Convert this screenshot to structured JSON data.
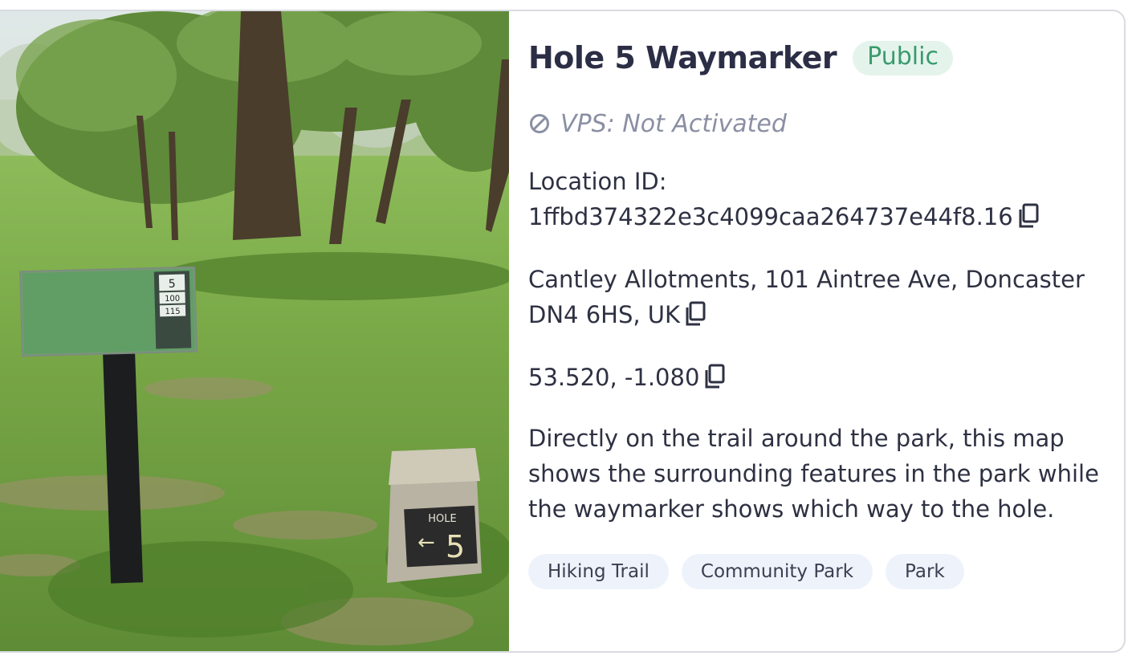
{
  "card": {
    "title": "Hole 5 Waymarker",
    "visibility_badge": "Public",
    "vps_status": "VPS: Not Activated",
    "location_id_label": "Location ID:",
    "location_id": "1ffbd374322e3c4099caa264737e44f8.16",
    "address_line1": "Cantley Allotments, 101 Aintree Ave, Doncaster",
    "address_line2": "DN4 6HS, UK",
    "coordinates": "53.520, -1.080",
    "description": "Directly on the trail around the park, this map shows the surrounding features in the park while the waymarker shows which way to the hole.",
    "tags": [
      "Hiking Trail",
      "Community Park",
      "Park"
    ]
  },
  "photo": {
    "sign_number": "5",
    "sign_yards_1": "100",
    "sign_yards_2": "115",
    "stone_label": "HOLE",
    "stone_number": "5"
  },
  "colors": {
    "badge_bg": "#e4f4ec",
    "badge_text": "#3a9a6d",
    "tag_bg": "#eef3fb",
    "muted_text": "#8a8fa3",
    "title_text": "#2b2e45"
  },
  "icons": {
    "vps": "prohibited-icon",
    "copy": "copy-icon"
  }
}
